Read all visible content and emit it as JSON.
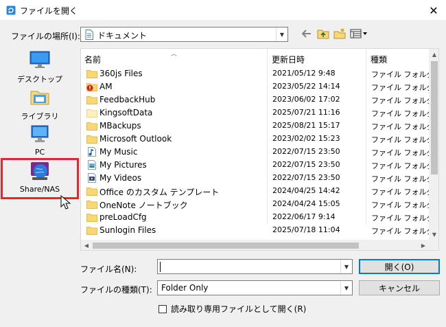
{
  "window": {
    "title": "ファイルを開く",
    "close_glyph": "✕"
  },
  "lookin": {
    "label": "ファイルの場所(I):",
    "value": "ドキュメント"
  },
  "toolbar": {
    "icons": [
      "back-arrow-icon",
      "up-folder-icon",
      "new-folder-icon",
      "view-menu-icon"
    ]
  },
  "places": [
    {
      "label": "デスクトップ",
      "icon": "desktop-icon"
    },
    {
      "label": "ライブラリ",
      "icon": "library-icon"
    },
    {
      "label": "PC",
      "icon": "pc-icon"
    },
    {
      "label": "Share/NAS",
      "icon": "share-nas-icon",
      "selected": true
    }
  ],
  "list": {
    "columns": [
      "名前",
      "更新日時",
      "種類"
    ],
    "rows": [
      {
        "name": "360js Files",
        "date": "2021/05/12 9:48",
        "type": "ファイル フォルダー",
        "icon": "folder"
      },
      {
        "name": "AM",
        "date": "2023/05/22 14:14",
        "type": "ファイル フォルダー",
        "icon": "folder-warning"
      },
      {
        "name": "FeedbackHub",
        "date": "2023/06/02 17:02",
        "type": "ファイル フォルダー",
        "icon": "folder"
      },
      {
        "name": "KingsoftData",
        "date": "2025/07/21 11:16",
        "type": "ファイル フォルダー",
        "icon": "folder-empty"
      },
      {
        "name": "MBackups",
        "date": "2025/08/21 15:17",
        "type": "ファイル フォルダー",
        "icon": "folder"
      },
      {
        "name": "Microsoft Outlook",
        "date": "2023/02/02 15:23",
        "type": "ファイル フォルダー",
        "icon": "folder"
      },
      {
        "name": "My Music",
        "date": "2022/07/15 23:50",
        "type": "ファイル フォルダー",
        "icon": "music"
      },
      {
        "name": "My Pictures",
        "date": "2022/07/15 23:50",
        "type": "ファイル フォルダー",
        "icon": "pictures"
      },
      {
        "name": "My Videos",
        "date": "2022/07/15 23:50",
        "type": "ファイル フォルダー",
        "icon": "videos"
      },
      {
        "name": "Office のカスタム テンプレート",
        "date": "2024/04/25 14:42",
        "type": "ファイル フォルダー",
        "icon": "folder"
      },
      {
        "name": "OneNote ノートブック",
        "date": "2024/04/24 15:05",
        "type": "ファイル フォルダー",
        "icon": "folder"
      },
      {
        "name": "preLoadCfg",
        "date": "2022/06/17 9:14",
        "type": "ファイル フォルダー",
        "icon": "folder"
      },
      {
        "name": "Sunlogin Files",
        "date": "2025/07/18 11:04",
        "type": "ファイル フォルダー",
        "icon": "folder"
      }
    ]
  },
  "filename": {
    "label": "ファイル名(N):",
    "value": ""
  },
  "filetype": {
    "label": "ファイルの種類(T):",
    "value": "Folder Only"
  },
  "buttons": {
    "open": "開く(O)",
    "cancel": "キャンセル"
  },
  "readonly": {
    "label": "読み取り専用ファイルとして開く(R)",
    "checked": false
  },
  "colors": {
    "folder": "#f8d775",
    "folder_dark": "#e9b948",
    "highlight": "#e8242d",
    "accent": "#0078d7"
  }
}
